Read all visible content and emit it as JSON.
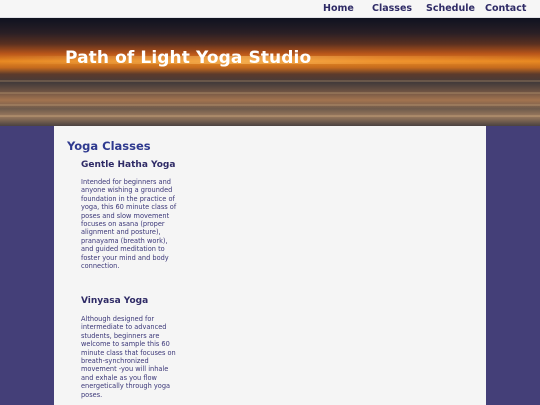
{
  "nav": {
    "items": [
      "Home",
      "Classes",
      "Schedule",
      "Contact"
    ]
  },
  "hero": {
    "title": "Path of Light Yoga Studio"
  },
  "main": {
    "heading": "Yoga Classes",
    "classes": [
      {
        "name": "Gentle Hatha Yoga",
        "description": "Intended for beginners and anyone wishing a grounded foundation in the practice of yoga, this 60 minute class of poses and slow movement focuses on asana (proper alignment and posture), pranayama (breath work), and guided meditation to foster your mind and body connection."
      },
      {
        "name": "Vinyasa Yoga",
        "description": "Although designed for intermediate to advanced students, beginners are welcome to sample this 60 minute class that focuses on breath-synchronized movement -you will inhale and exhale as you flow energetically through yoga poses."
      }
    ]
  },
  "colors": {
    "page_background": "#443f78",
    "content_background": "#f5f5f5",
    "nav_background": "#f6f6f6",
    "heading": "#2f3a8f",
    "text": "#3b3778"
  }
}
